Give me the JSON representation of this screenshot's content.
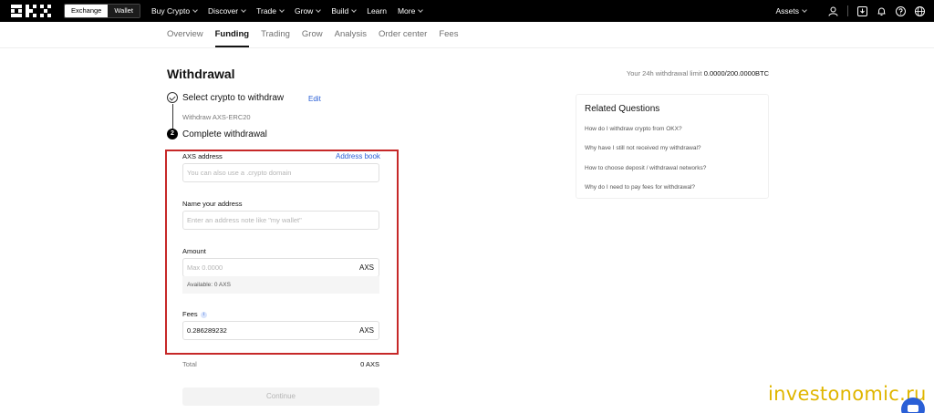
{
  "nav": {
    "segment": [
      "Exchange",
      "Wallet"
    ],
    "menu": [
      "Buy Crypto",
      "Discover",
      "Trade",
      "Grow",
      "Build",
      "Learn",
      "More"
    ],
    "assets": "Assets"
  },
  "subnav": {
    "tabs": [
      "Overview",
      "Funding",
      "Trading",
      "Grow",
      "Analysis",
      "Order center",
      "Fees"
    ],
    "active": "Funding"
  },
  "page": {
    "title": "Withdrawal",
    "limit_label": "Your 24h withdrawal limit",
    "limit_value": "0.0000/200.0000BTC"
  },
  "steps": {
    "step1": "Select crypto to withdraw",
    "edit": "Edit",
    "step1_sub": "Withdraw AXS-ERC20",
    "step2_num": "2",
    "step2": "Complete withdrawal"
  },
  "form": {
    "address_label": "AXS address",
    "address_book": "Address book",
    "address_placeholder": "You can also use a .crypto domain",
    "name_label": "Name your address",
    "name_placeholder": "Enter an address note like \"my wallet\"",
    "amount_label": "Amount",
    "amount_placeholder": "Max 0.0000",
    "amount_unit": "AXS",
    "available": "Available:  0 AXS",
    "fees_label": "Fees",
    "fees_value": "0.286289232",
    "fees_unit": "AXS",
    "total_label": "Total",
    "total_value": "0 AXS",
    "continue": "Continue"
  },
  "related": {
    "title": "Related Questions",
    "questions": [
      "How do I withdraw crypto from OKX?",
      "Why have I still not received my withdrawal?",
      "How to choose deposit / withdrawal networks?",
      "Why do I need to pay fees for withdrawal?"
    ]
  },
  "watermark": "investonomic.ru",
  "colors": {
    "accent": "#2a5fd6",
    "highlight": "#c62828",
    "watermark": "#e0b600"
  }
}
